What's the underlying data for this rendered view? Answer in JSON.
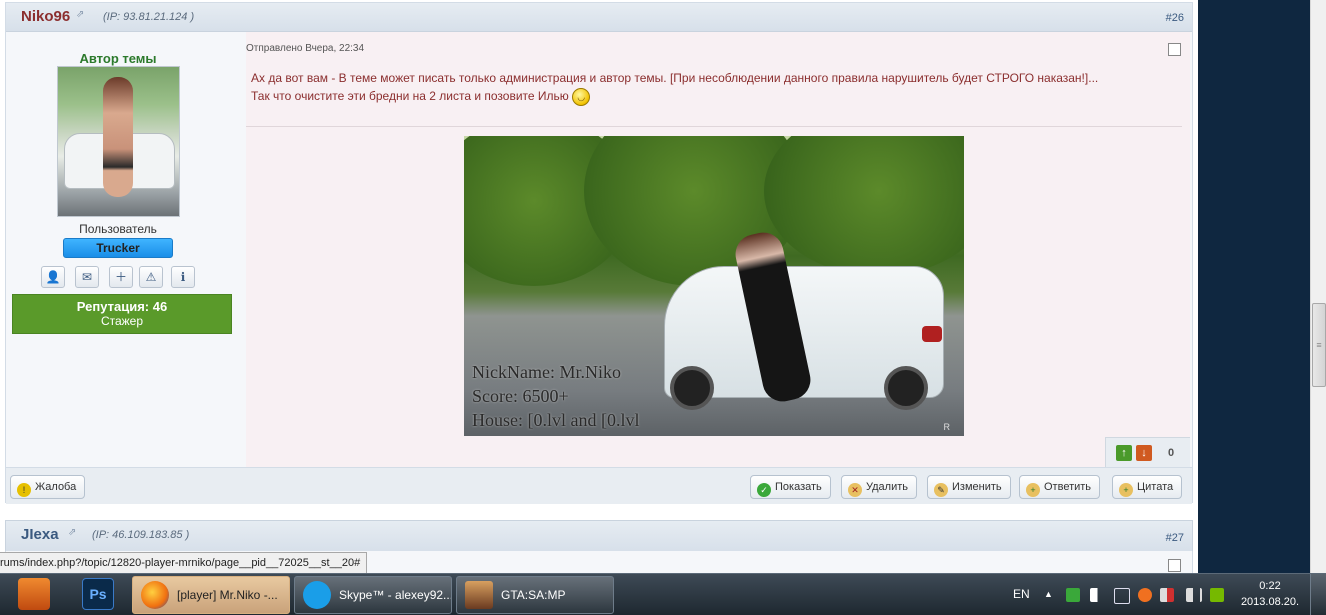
{
  "post": {
    "author": "Niko96",
    "ip_label": "(IP: ",
    "ip": "93.81.21.124",
    "ip_close": " )",
    "number": "#26",
    "topic_author_label": "Автор темы",
    "user_role": "Пользователь",
    "group": "Trucker",
    "reputation_label": "Репутация: 46",
    "reputation_rank": "Стажер",
    "posted": "Отправлено Вчера, 22:34",
    "message_line1": "Ах да вот вам - В теме может писать только администрация и автор темы. [При несоблюдении данного правила нарушитель будет СТРОГО наказан!]...",
    "message_line2": "Так что очистите эти бредни на 2 листа и позовите Илью",
    "image_caption": [
      "NickName: Mr.Niko",
      "Score: 6500+",
      "House: [0.lvl and [0.lvl"
    ],
    "vote_count": "0",
    "buttons": {
      "report": "Жалоба",
      "show": "Показать",
      "delete": "Удалить",
      "edit": "Изменить",
      "reply": "Ответить",
      "quote": "Цитата"
    }
  },
  "next_post": {
    "author": "JIexa",
    "ip_label": "(IP: ",
    "ip": "46.109.183.85",
    "ip_close": " )",
    "number": "#27"
  },
  "status_url": "rums/index.php?/topic/12820-player-mrniko/page__pid__72025__st__20#",
  "taskbar": {
    "tasks": [
      "[player] Mr.Niko -...",
      "Skype™ - alexey92...",
      "GTA:SA:MP"
    ],
    "ps_label": "Ps",
    "language": "EN",
    "time": "0:22",
    "date": "2013.08.20."
  },
  "colors": {
    "author": "#8b2e2e",
    "reputation": "#5a9a2a",
    "group_badge": "#1a8ee8",
    "topic_author": "#2c7a2c"
  }
}
